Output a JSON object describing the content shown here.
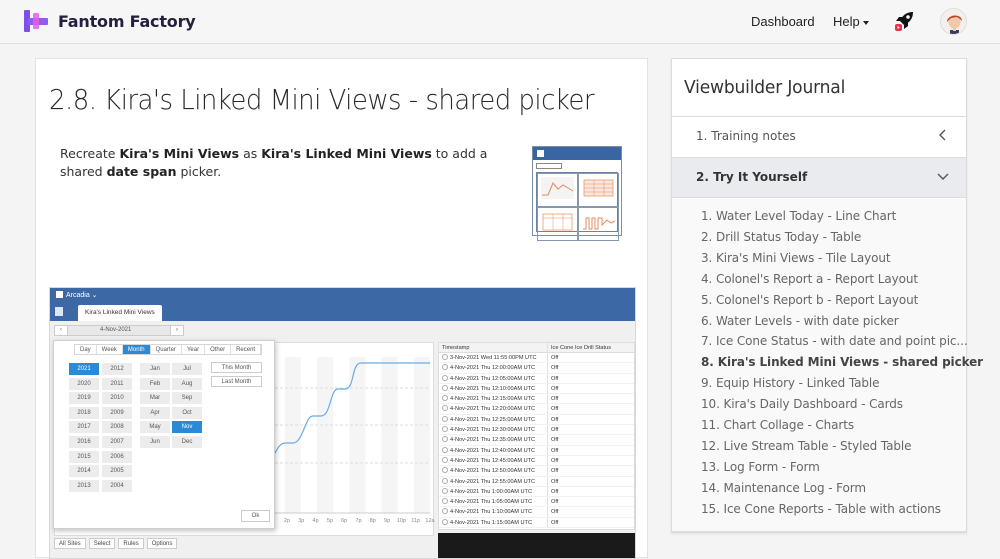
{
  "header": {
    "brand": "Fantom Factory",
    "nav": {
      "dashboard": "Dashboard",
      "help": "Help"
    },
    "icons": [
      "rocket-icon",
      "avatar"
    ]
  },
  "main": {
    "title": "2.8. Kira's Linked Mini Views - shared picker",
    "intro": {
      "t1": "Recreate ",
      "b1": "Kira's Mini Views",
      "t2": " as ",
      "b2": "Kira's Linked Mini Views",
      "t3": " to add a shared ",
      "b3": "date span",
      "t4": " picker."
    },
    "screenshot": {
      "app_name": "Arcadia",
      "tab": "Kira's Linked Mini Views",
      "date": "4-Nov-2021",
      "picker_tabs": [
        "Day",
        "Week",
        "Month",
        "Quarter",
        "Year",
        "Other",
        "Recent"
      ],
      "picker_active_tab": "Month",
      "years_col1": [
        "2021",
        "2020",
        "2019",
        "2018",
        "2017",
        "2016",
        "2015",
        "2014",
        "2013"
      ],
      "years_col2": [
        "2012",
        "2011",
        "2010",
        "2009",
        "2008",
        "2007",
        "2006",
        "2005",
        "2004"
      ],
      "selected_year": "2021",
      "months_col1": [
        "Jan",
        "Feb",
        "Mar",
        "Apr",
        "May",
        "Jun"
      ],
      "months_col2": [
        "Jul",
        "Aug",
        "Sep",
        "Oct",
        "Nov",
        "Dec"
      ],
      "selected_month": "Nov",
      "quick": [
        "This Month",
        "Last Month"
      ],
      "ok": "Ok",
      "x_ticks": [
        "2p",
        "3p",
        "4p",
        "5p",
        "6p",
        "7p",
        "8p",
        "9p",
        "10p",
        "11p",
        "12a"
      ],
      "table_headers": [
        "Timestamp",
        "Ice Cone Ice Drill Status"
      ],
      "table_rows": [
        [
          "3-Nov-2021 Wed 11:55:00PM UTC",
          "Off"
        ],
        [
          "4-Nov-2021 Thu 12:00:00AM UTC",
          "Off"
        ],
        [
          "4-Nov-2021 Thu 12:05:00AM UTC",
          "Off"
        ],
        [
          "4-Nov-2021 Thu 12:10:00AM UTC",
          "Off"
        ],
        [
          "4-Nov-2021 Thu 12:15:00AM UTC",
          "Off"
        ],
        [
          "4-Nov-2021 Thu 12:20:00AM UTC",
          "Off"
        ],
        [
          "4-Nov-2021 Thu 12:25:00AM UTC",
          "Off"
        ],
        [
          "4-Nov-2021 Thu 12:30:00AM UTC",
          "Off"
        ],
        [
          "4-Nov-2021 Thu 12:35:00AM UTC",
          "Off"
        ],
        [
          "4-Nov-2021 Thu 12:40:00AM UTC",
          "Off"
        ],
        [
          "4-Nov-2021 Thu 12:45:00AM UTC",
          "Off"
        ],
        [
          "4-Nov-2021 Thu 12:50:00AM UTC",
          "Off"
        ],
        [
          "4-Nov-2021 Thu 12:55:00AM UTC",
          "Off"
        ],
        [
          "4-Nov-2021 Thu 1:00:00AM UTC",
          "Off"
        ],
        [
          "4-Nov-2021 Thu 1:05:00AM UTC",
          "Off"
        ],
        [
          "4-Nov-2021 Thu 1:10:00AM UTC",
          "Off"
        ],
        [
          "4-Nov-2021 Thu 1:15:00AM UTC",
          "Off"
        ]
      ],
      "bottom_tabs": [
        "All Sites",
        "Select",
        "Rules",
        "Options"
      ]
    }
  },
  "sidebar": {
    "title": "Viewbuilder Journal",
    "sections": [
      {
        "label": "1. Training notes",
        "expanded": false
      },
      {
        "label": "2. Try It Yourself",
        "expanded": true
      }
    ],
    "items": [
      "1. Water Level Today - Line Chart",
      "2. Drill Status Today - Table",
      "3. Kira's Mini Views - Tile Layout",
      "4. Colonel's Report a - Report Layout",
      "5. Colonel's Report b - Report Layout",
      "6. Water Levels - with date picker",
      "7. Ice Cone Status - with date and point pic...",
      "8. Kira's Linked Mini Views - shared picker",
      "9. Equip History - Linked Table",
      "10. Kira's Daily Dashboard - Cards",
      "11. Chart Collage - Charts",
      "12. Live Stream Table - Styled Table",
      "13. Log Form - Form",
      "14. Maintenance Log - Form",
      "15. Ice Cone Reports - Table with actions"
    ],
    "active_index": 7
  },
  "colors": {
    "accent": "#2b8ad6",
    "app_header": "#3c68a6",
    "brand": "#7b4fe8"
  }
}
